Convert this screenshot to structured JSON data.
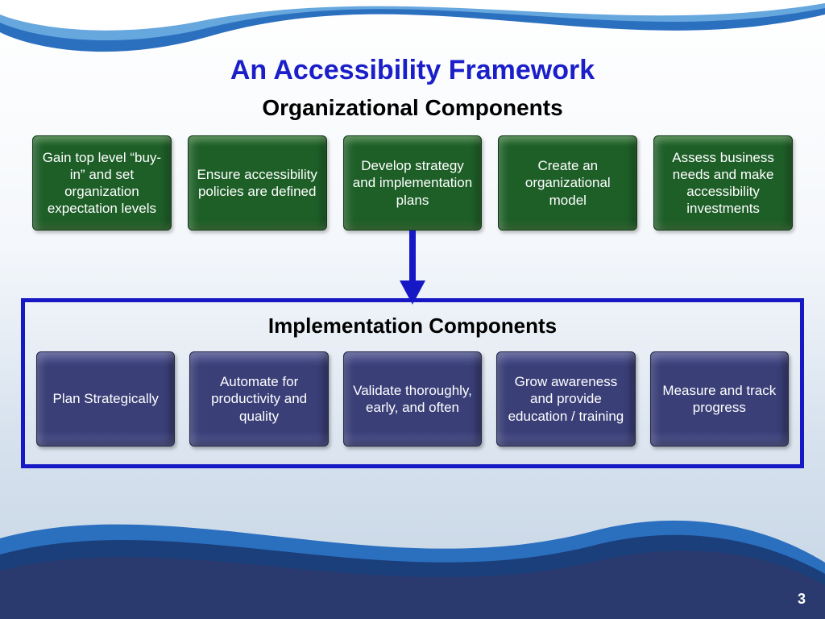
{
  "title": "An Accessibility Framework",
  "section_org": "Organizational Components",
  "section_impl": "Implementation Components",
  "org_boxes": [
    "Gain top level “buy-in” and set organization expectation levels",
    "Ensure accessibility policies are defined",
    "Develop strategy and implementation plans",
    "Create an organizational model",
    "Assess business needs and make accessibility investments"
  ],
  "impl_boxes": [
    "Plan Strategically",
    "Automate for productivity and quality",
    "Validate thoroughly, early, and often",
    "Grow awareness and provide education / training",
    "Measure and track progress"
  ],
  "page_number": "3",
  "colors": {
    "title": "#1a1fc9",
    "arrow": "#1518c4",
    "group_border": "#1518c4",
    "green_box": "#1e5f28",
    "purple_box": "#3a3f78"
  }
}
